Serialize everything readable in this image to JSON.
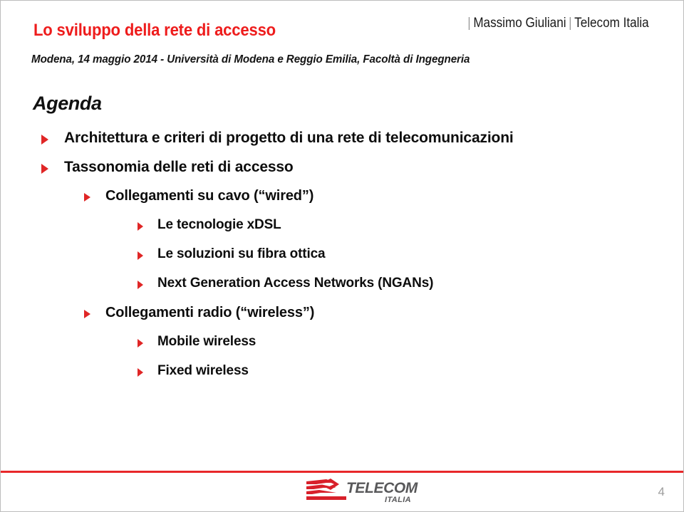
{
  "slide": {
    "accent_red": "#ee1c1c",
    "rule_red": "#e8282a",
    "bullet_red": "#e02626",
    "text_black": "#0d0d0d",
    "page_number": "4"
  },
  "header": {
    "deck_title": "Lo sviluppo della rete di accesso",
    "author": "Massimo Giuliani",
    "company": "Telecom Italia",
    "separator": "|",
    "event_line": "Modena,  14 maggio 2014 - Università di Modena e Reggio Emilia, Facoltà di Ingegneria"
  },
  "body": {
    "section_heading": "Agenda",
    "bullets": [
      {
        "level": 1,
        "text": "Architettura e criteri di progetto di una rete di telecomunicazioni"
      },
      {
        "level": 1,
        "text": "Tassonomia delle reti di accesso"
      },
      {
        "level": 2,
        "text": "Collegamenti su cavo (“wired”)"
      },
      {
        "level": 3,
        "text": "Le tecnologie xDSL"
      },
      {
        "level": 3,
        "text": "Le soluzioni su fibra ottica"
      },
      {
        "level": 3,
        "text": "Next Generation Access Networks (NGANs)"
      },
      {
        "level": 2,
        "text": "Collegamenti radio (“wireless”)"
      },
      {
        "level": 3,
        "text": "Mobile wireless"
      },
      {
        "level": 3,
        "text": "Fixed wireless"
      }
    ]
  },
  "footer": {
    "logo_primary": "TELECOM",
    "logo_secondary": "ITALIA",
    "page_number": "4"
  }
}
